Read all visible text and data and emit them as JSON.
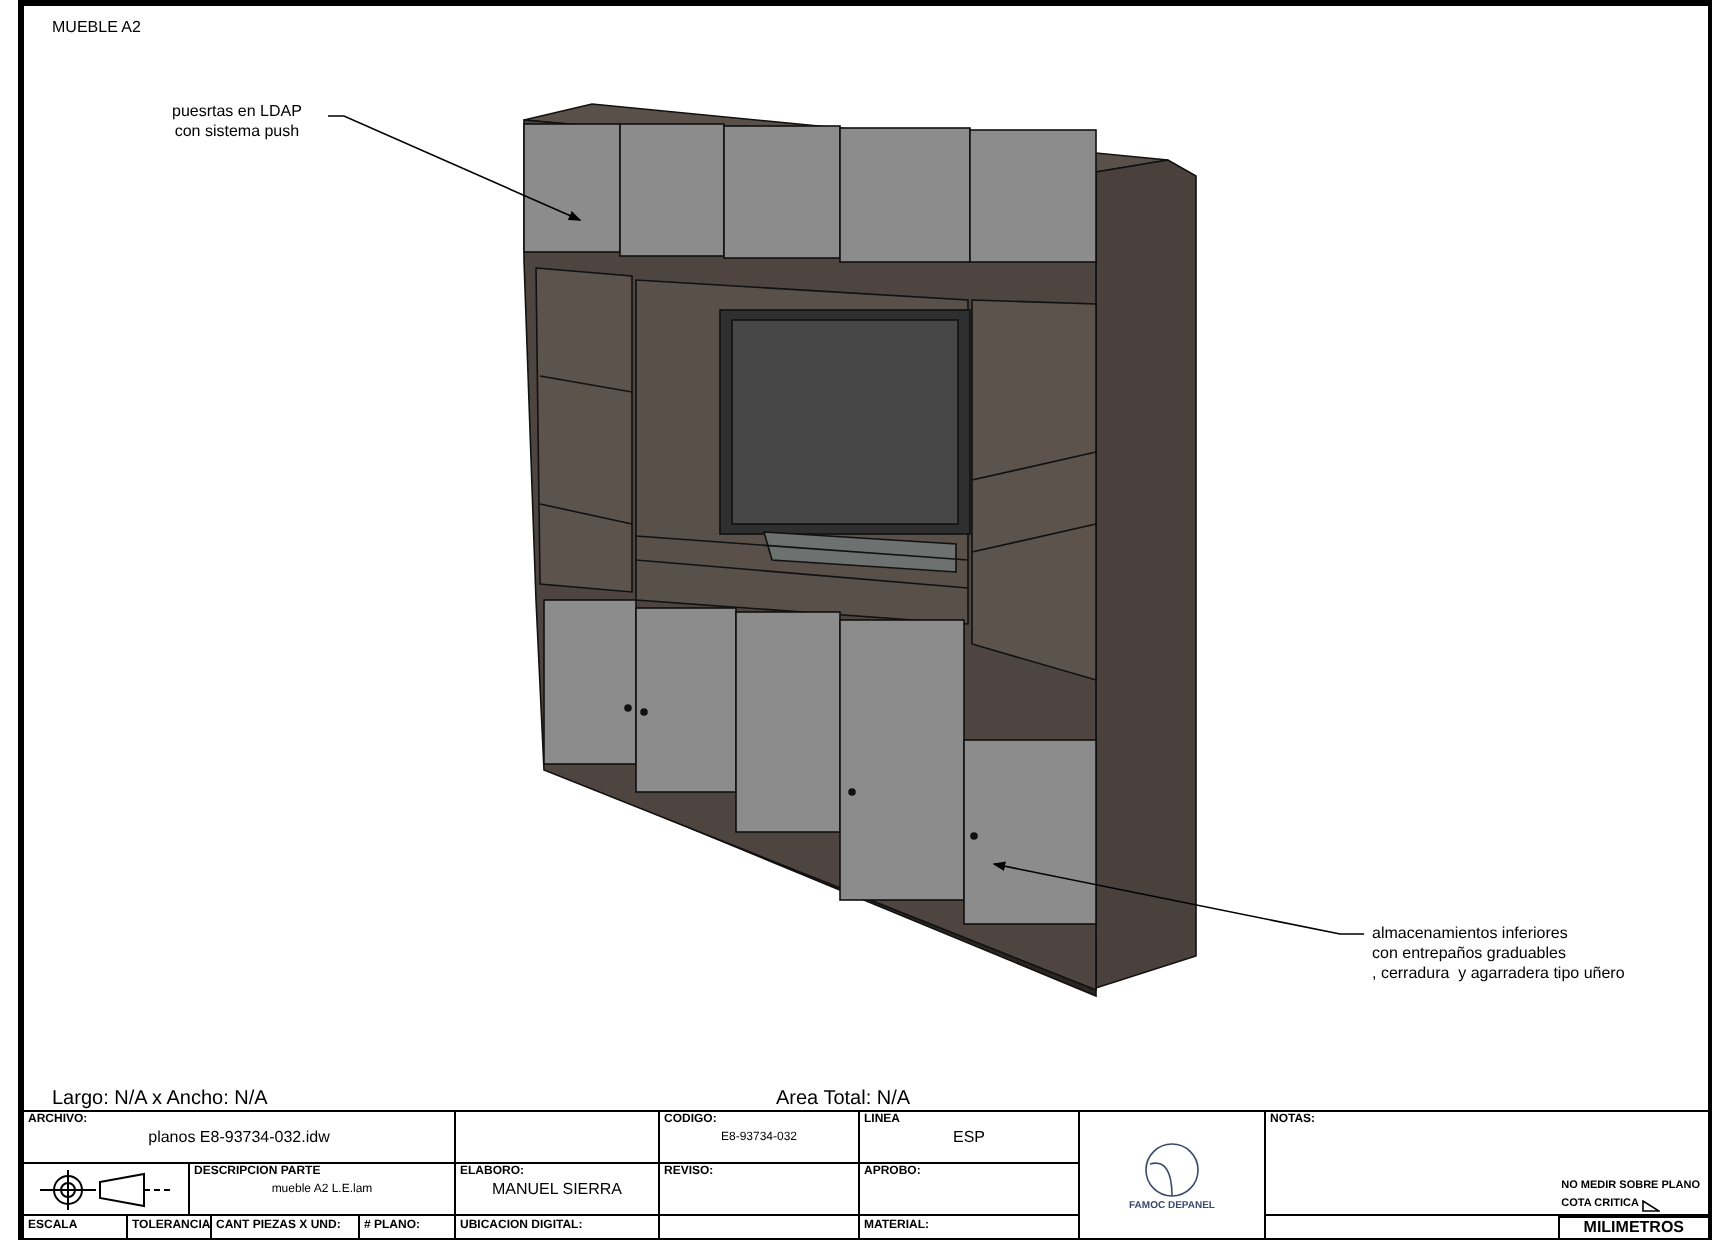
{
  "sheet": {
    "title": "MUEBLE A2"
  },
  "annotations": [
    {
      "lines": [
        "puesrtas en LDAP",
        "con sistema push"
      ]
    },
    {
      "lines": [
        "almacenamientos inferiores",
        "con entrepaños graduables",
        ", cerradura  y agarradera tipo uñero"
      ]
    }
  ],
  "dimensions": {
    "size": "Largo: N/A x Ancho: N/A",
    "area": "Area Total: N/A"
  },
  "title_block": {
    "archivo": {
      "label": "ARCHIVO:",
      "value": "planos E8-93734-032.idw"
    },
    "codigo": {
      "label": "CODIGO:",
      "value": "E8-93734-032"
    },
    "linea": {
      "label": "LINEA",
      "value": "ESP"
    },
    "notas": {
      "label": "NOTAS:",
      "lines": [
        "NO MEDIR SOBRE PLANO",
        "COTA CRITICA"
      ]
    },
    "descripcion": {
      "label": "DESCRIPCION PARTE",
      "value": "mueble A2 L.E.lam"
    },
    "elaboro": {
      "label": "ELABORO:",
      "value": "MANUEL SIERRA"
    },
    "reviso": {
      "label": "REVISO:"
    },
    "aprobo": {
      "label": "APROBO:"
    },
    "bottom_labels": [
      "ESCALA",
      "TOLERANCIA",
      "CANT PIEZAS X UND:",
      "# PLANO:",
      "UBICACION DIGITAL:"
    ],
    "material": {
      "label": "MATERIAL:"
    },
    "units": "MILIMETROS",
    "logo": {
      "name": "FAMOC DEPANEL"
    }
  }
}
